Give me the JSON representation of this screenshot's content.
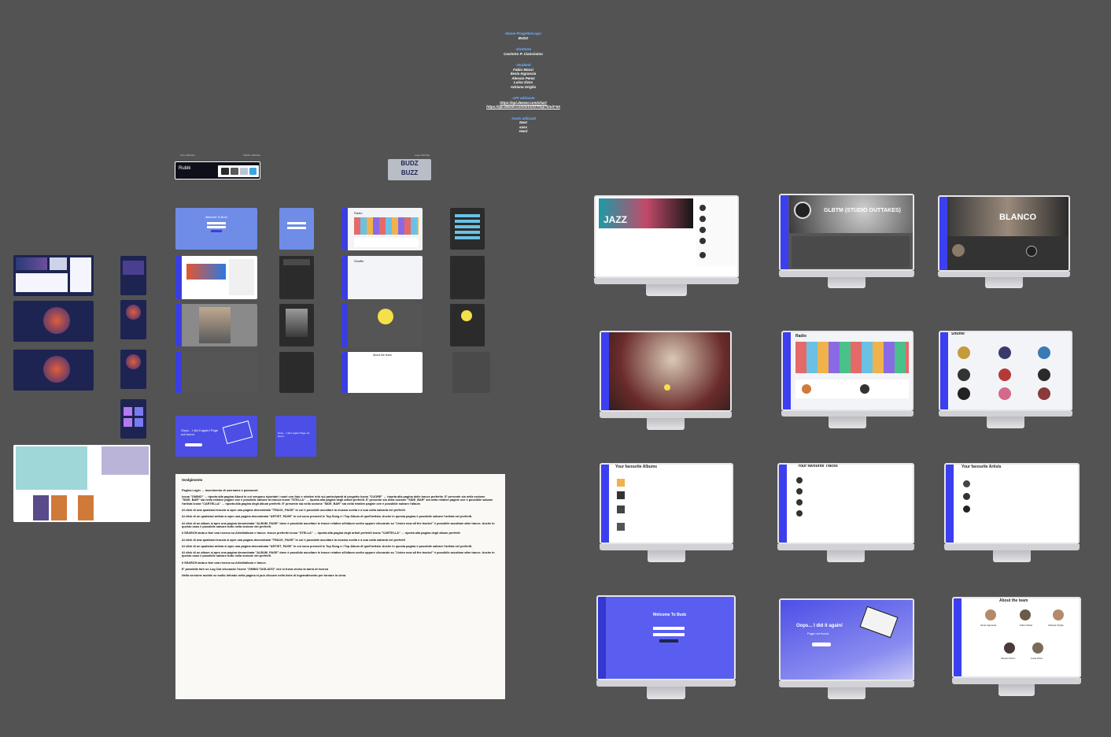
{
  "info": {
    "project_label": "-Nome Progetto/Logo:",
    "project_value": "BUDZ",
    "director_label": "-Direttore",
    "director_value": "Casimiro P. Ciancimino",
    "students_label": "-Studenti",
    "students": [
      "Fabio Massi",
      "Ilenia Ingrassia",
      "Alessio Perez",
      "Luisa Zizzo",
      "Adriana Origlio"
    ],
    "api_label": "-API utilizzate",
    "apis": [
      "https://api.deezer.com/chart",
      "https://api.deezer.com/artist/27/top?limit=50"
    ],
    "tools_label": "-Tools utilizzati",
    "tools": [
      "Next",
      "sass",
      "react"
    ]
  },
  "brand": {
    "font_label": "Font utilizzato",
    "palette_label": "Palette utilizzata",
    "logo_label": "Logo utilizzato",
    "font_name": "Rubik",
    "logo_top": "BUDZ",
    "logo_bottom": "BUZZ",
    "palette": [
      "#2b2b2b",
      "#5a5a5a",
      "#b9c4d4",
      "#3aa6e0"
    ]
  },
  "mockups": {
    "home_title": "JAZZ",
    "album_title": "GLBTM (STUDIO OUTTAKES)",
    "artist_title": "BLANCO",
    "radio_title": "Radio",
    "shuffle_title": "Shuffle",
    "fav_albums": "Your favourite Albums",
    "fav_tracks": "Your favourite Tracks",
    "fav_artists": "Your favourite Artists",
    "login_title": "Welcome To Budz",
    "notfound_title": "Oops... I did it again!",
    "notfound_sub": "Page not found",
    "about_title": "About the team",
    "small_login": "Welcome To Budz",
    "small_oops": "Oops... I did it again! Page not found",
    "team": [
      "Ilenia Ingrassia",
      "Fabio Massi",
      "Adriana Origlio",
      "Alessio Perez",
      "Luisa Zizzo"
    ]
  },
  "doc": {
    "heading": "Svolgimento",
    "paragraphs": [
      "Pagina Login → inserimento di username e password",
      "Icona \"OMINO\" → riporta alla pagina About in cui vengono riportate i nomi con foto e relative info sui partecipanti al progetto Icona \"CUORE\" → riporta alla pagina delle tracce preferite. E' presente sia nella sezione \"SIDE_BAR\" sia nella relative pagine ove è possibile salvare la traccia Icona \"STELLA\" → riporta alla pagina degli artisti preferiti. E' presente sia nella sezione \"SIDE_BAR\" sia nella relative pagine ove è possibile salvare l'artista Icona \"CARTELLA\" → riporta alla pagina degli album preferiti. E' presente sia nella sezione \"SIDE_BAR\" sia nella relative pagine ove è possibile salvare l'album",
      "Al click di una qualsiasi traccia si apre una pagina denominata \"TRACK_PAGE\" in cui è possibile ascoltare la musica scelta e a sua volta salvarla nei preferiti",
      "Al click di un qualsiasi artista si apre una pagina denominata \"ARTIST_PAGE\" in cui sono presenti le Top Song e i Top Album di quell'artista. Anche in questa pagina è possibile salvare l'artista nei preferiti.",
      "Al click di un album si apre una pagina denominata \"ALBUM_PAGE\" dove è possibile ascoltare le tracce relative all'album scelto oppure cliccando su \"Listen now all the tracks!\" è possibile ascoltare altre tracce. Anche in questo caso è possibile salvare tutto nella sezione dei preferiti.",
      "il SEARCH aiuta a fare una ricerca su Artisti/album e tracce. tracce preferite Icona \"STELLA\" → riporta alla pagina degli artisti preferiti Icona \"CARTELLA\" → riporta alla pagina degli album preferiti",
      "Al click di una qualsiasi traccia si apre una pagina denominata \"TRACK_PAGE\" in cui è possibile ascoltare la musica scelta e a sua volta salvarla nei preferiti",
      "Al click di un qualsiasi artista si apre una pagina denominata \"ARTIST_PAGE\" in cui sono presenti le Top Song e i Top Album di quell'artista. Anche in questa pagina è possibile salvare l'artista nei preferiti.",
      "Al click di un album si apre una pagina denominata \"ALBUM_PAGE\" dove è possibile ascoltare le tracce relative all'album scelto oppure cliccando su \"Listen now all the tracks!\" è possibile ascoltare altre tracce. Anche in questo caso è possibile salvare tutto nella sezione dei preferiti.",
      "il SEARCH aiuta a fare una ricerca su Artisti/album e tracce.",
      "E' possibile fare un Log Out cliccando l'icone \"OMINO TAGLIATO\" che si trova vicino la barra di ricerca",
      "Nella versione mobile se molto infondo nella pagina si può cliccare nella lente di ingrandimento per tornare in cima."
    ]
  }
}
